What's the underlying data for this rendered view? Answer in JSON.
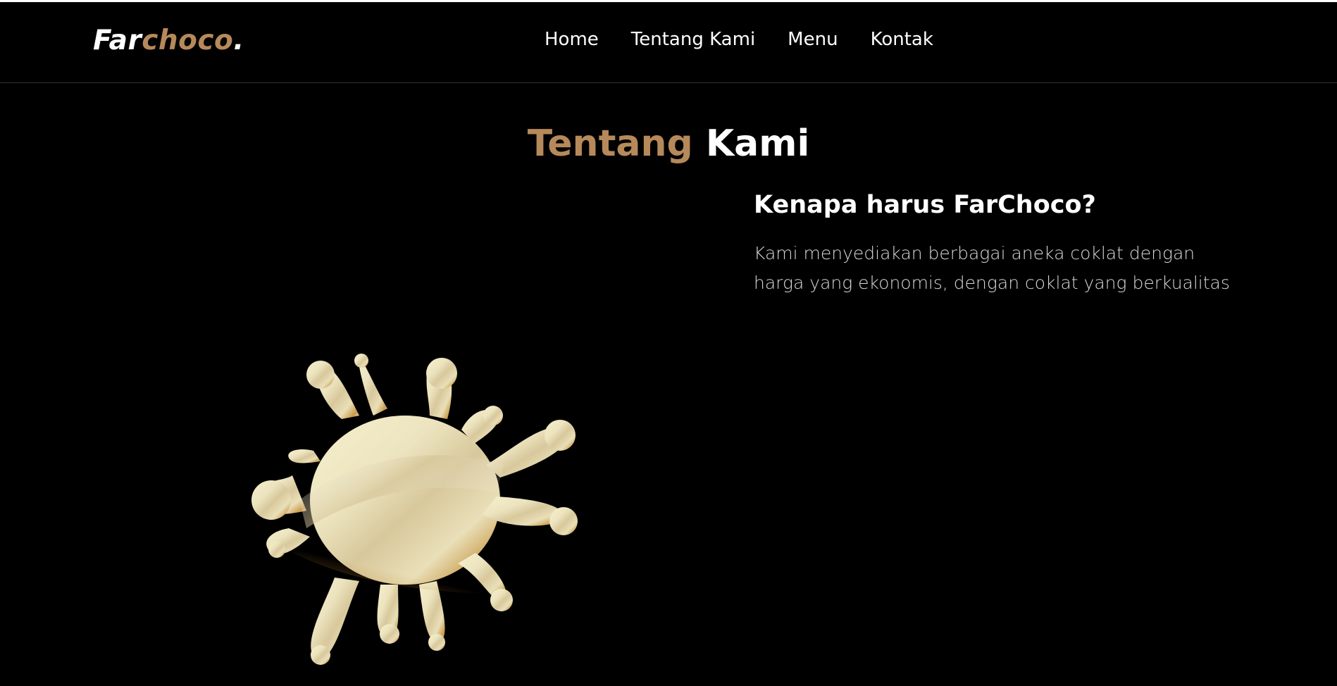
{
  "navbar": {
    "logo": {
      "part1": "Far",
      "part2": "choco",
      "dot": "."
    },
    "links": [
      "Home",
      "Tentang Kami",
      "Menu",
      "Kontak"
    ]
  },
  "about": {
    "title_accent": "Tentang",
    "title_main": "Kami",
    "heading": "Kenapa harus FarChoco?",
    "text": "Kami menyediakan berbagai aneka coklat dengan harga yang ekonomis, dengan coklat yang berkualitas"
  },
  "colors": {
    "background": "#000000",
    "accent": "#b6895b",
    "text": "#ffffff"
  },
  "icons": {
    "splash": "white-chocolate-splash-image"
  }
}
